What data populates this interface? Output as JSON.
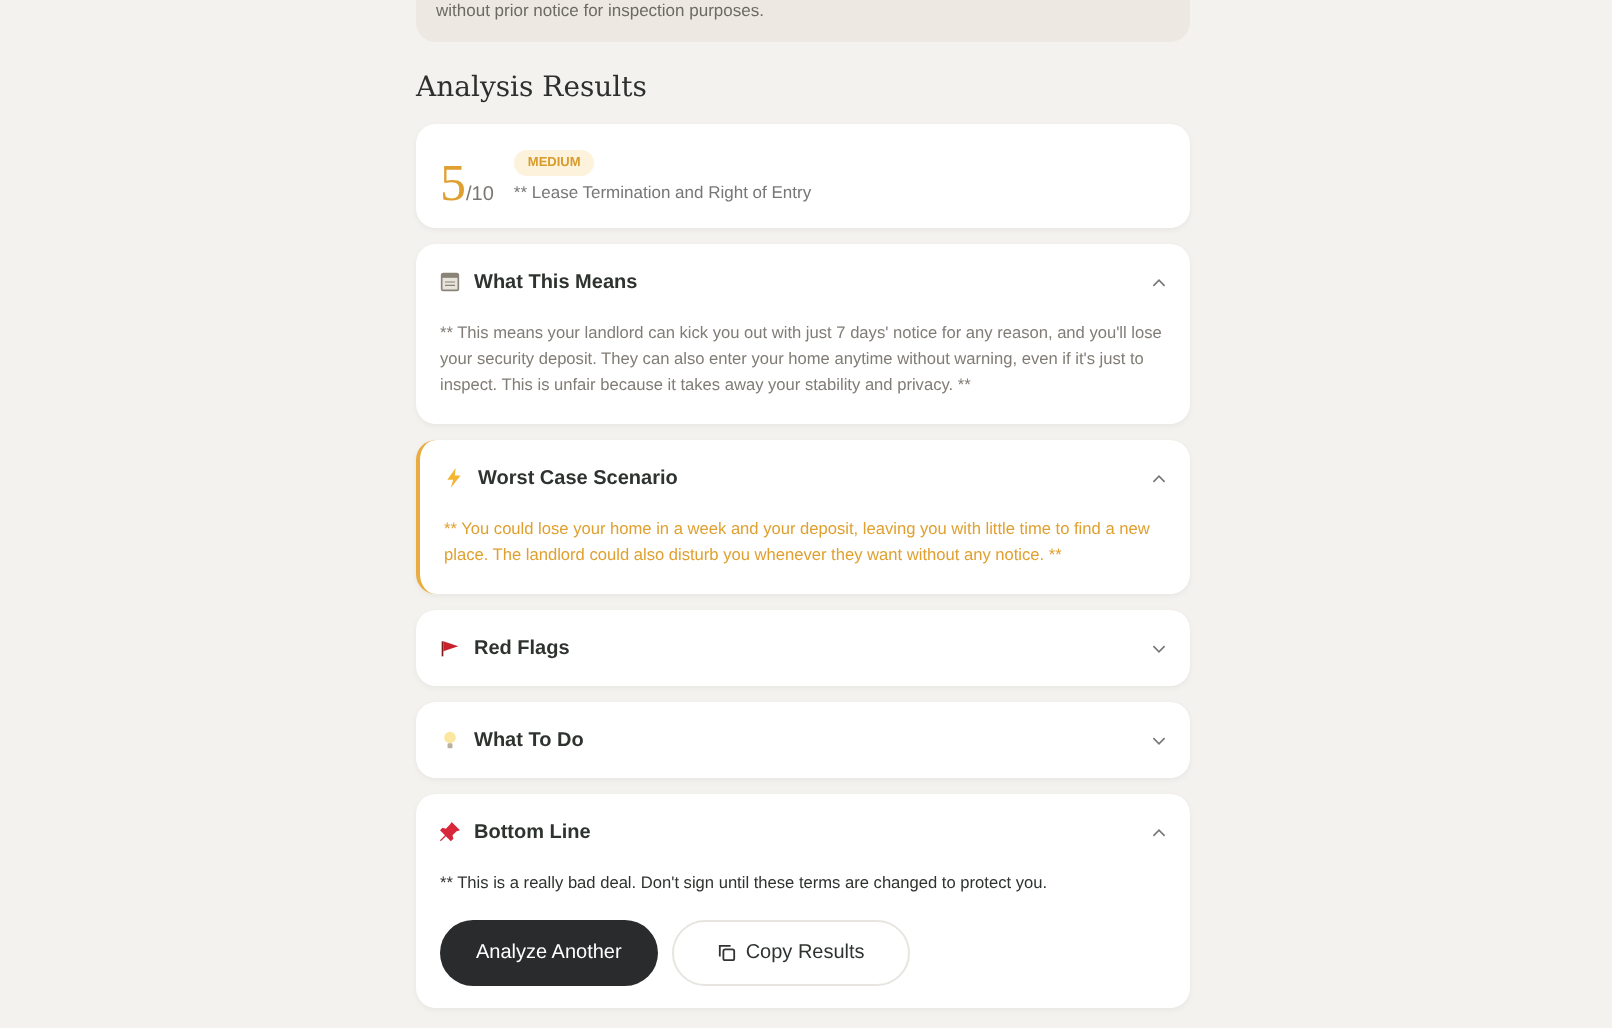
{
  "clause_card": {
    "text": "without prior notice for inspection purposes."
  },
  "heading": "Analysis Results",
  "score": {
    "value": "5",
    "max": "/10",
    "severity": "MEDIUM",
    "title": "** Lease Termination and Right of Entry"
  },
  "sections": [
    {
      "kind": "notes",
      "title": "What This Means",
      "expanded": true,
      "body": "** This means your landlord can kick you out with just 7 days' notice for any reason, and you'll lose your security deposit. They can also enter your home anytime without warning, even if it's just to inspect. This is unfair because it takes away your stability and privacy. **"
    },
    {
      "kind": "bolt",
      "title": "Worst Case Scenario",
      "expanded": true,
      "body": "** You could lose your home in a week and your deposit, leaving you with little time to find a new place. The landlord could also disturb you whenever they want without any notice. **"
    },
    {
      "kind": "flag",
      "title": "Red Flags",
      "expanded": false
    },
    {
      "kind": "bulb",
      "title": "What To Do",
      "expanded": false
    },
    {
      "kind": "pin",
      "title": "Bottom Line",
      "expanded": true,
      "body": "** This is a really bad deal. Don't sign until these terms are changed to protect you."
    }
  ],
  "actions": [
    {
      "kind": "primary",
      "label": "Analyze Another"
    },
    {
      "kind": "copy",
      "label": "Copy Results"
    }
  ]
}
